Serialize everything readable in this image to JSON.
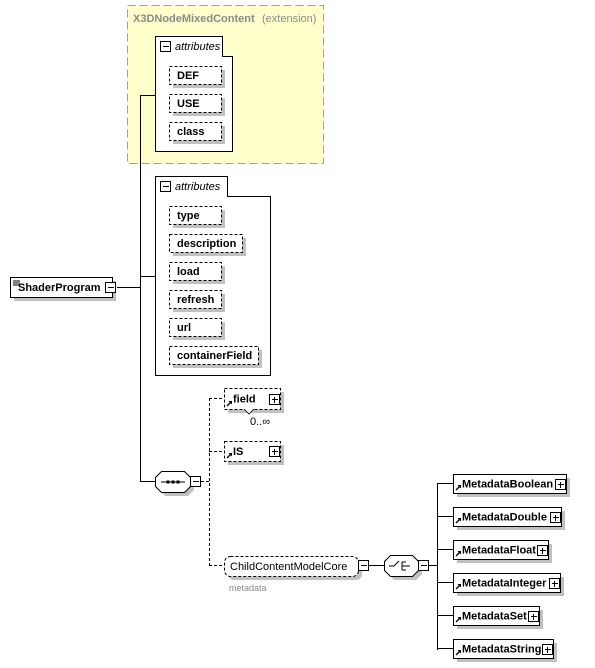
{
  "colors": {
    "extension_fill": "#ffffcc",
    "extension_border": "#a0a0a0",
    "shadow": "#c0c0c0",
    "line": "#000000",
    "muted_text": "#8a8a8a"
  },
  "root": {
    "label": "ShaderProgram",
    "icon": "element-doc-icon"
  },
  "extension": {
    "title": "X3DNodeMixedContent",
    "suffix": "(extension)",
    "attributes_label": "attributes",
    "attributes": [
      "DEF",
      "USE",
      "class"
    ]
  },
  "own_attributes": {
    "label": "attributes",
    "items": [
      "type",
      "description",
      "load",
      "refresh",
      "url",
      "containerField"
    ]
  },
  "sequence": {
    "children": [
      {
        "label": "field",
        "cardinality": "0..∞"
      },
      {
        "label": "IS"
      }
    ],
    "group": {
      "label": "ChildContentModelCore",
      "caption": "metadata"
    }
  },
  "choice": {
    "items": [
      "MetadataBoolean",
      "MetadataDouble",
      "MetadataFloat",
      "MetadataInteger",
      "MetadataSet",
      "MetadataString"
    ]
  }
}
